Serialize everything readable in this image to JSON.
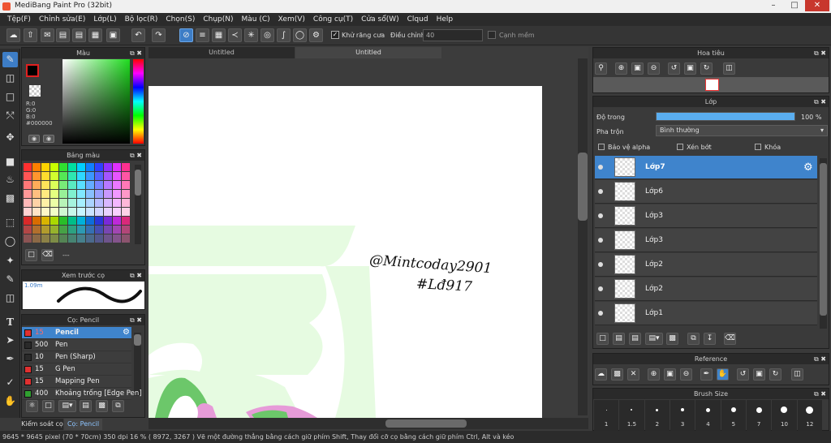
{
  "window": {
    "title": "MediBang Paint Pro (32bit)"
  },
  "menu": [
    "Tệp(F)",
    "Chỉnh sửa(E)",
    "Lớp(L)",
    "Bộ lọc(R)",
    "Chọn(S)",
    "Chụp(N)",
    "Màu (C)",
    "Xem(V)",
    "Công cụ(T)",
    "Cửa sổ(W)",
    "Clqud",
    "Help"
  ],
  "toolbar": {
    "antialias_label": "Khử răng cưa",
    "adjust_label": "Điều chỉnh",
    "adjust_value": "40",
    "edge_label": "Cạnh mềm"
  },
  "color_panel": {
    "title": "Màu",
    "r": "R:0",
    "g": "G:0",
    "b": "B:0",
    "hex": "#000000"
  },
  "palette_panel": {
    "title": "Bảng màu",
    "footer": "---"
  },
  "preview_panel": {
    "title": "Xem trước cọ",
    "size": "1.09m"
  },
  "brush_panel": {
    "title": "Cọ: Pencil",
    "brushes": [
      {
        "size": "15",
        "name": "Pencil",
        "color": "#e03030",
        "selected": true
      },
      {
        "size": "500",
        "name": "Pen",
        "color": "#2a2a2a",
        "selected": false
      },
      {
        "size": "10",
        "name": "Pen (Sharp)",
        "color": "#2a2a2a",
        "selected": false
      },
      {
        "size": "15",
        "name": "G Pen",
        "color": "#e03030",
        "selected": false
      },
      {
        "size": "15",
        "name": "Mapping Pen",
        "color": "#e03030",
        "selected": false
      },
      {
        "size": "400",
        "name": "Khoảng trống [Edge Pen]",
        "color": "#30a030",
        "selected": false
      }
    ]
  },
  "left_tabs": [
    "Kiểm soát cọ",
    "Cọ: Pencil"
  ],
  "doc_tabs": [
    "Untitled",
    "Untitled"
  ],
  "canvas": {
    "handwriting_line1": "@Mintcoday2901",
    "handwriting_line2": "#Lđ917"
  },
  "navigator": {
    "title": "Hoa tiêu"
  },
  "layer_panel": {
    "title": "Lớp",
    "opacity_label": "Độ trong",
    "opacity_value": "100 %",
    "opacity_fraction": 1.0,
    "blend_label": "Pha trộn",
    "blend_value": "Bình thường",
    "protect_alpha": "Bảo vệ alpha",
    "clip": "Xén bớt",
    "lock": "Khóa",
    "layers": [
      {
        "name": "Lớp7",
        "selected": true
      },
      {
        "name": "Lớp6",
        "selected": false
      },
      {
        "name": "Lớp3",
        "selected": false
      },
      {
        "name": "Lớp3",
        "selected": false
      },
      {
        "name": "Lớp2",
        "selected": false
      },
      {
        "name": "Lớp2",
        "selected": false
      },
      {
        "name": "Lớp1",
        "selected": false
      }
    ]
  },
  "reference_panel": {
    "title": "Reference"
  },
  "brush_size_panel": {
    "title": "Brush Size",
    "sizes": [
      "1",
      "1.5",
      "2",
      "3",
      "4",
      "5",
      "7",
      "10",
      "12"
    ]
  },
  "status": {
    "text": "9645 * 9645 pixel  (70 * 70cm)  350 dpi  16 %  ( 8972, 3267 )  Vẽ một đường thẳng bằng cách giữ phím Shift, Thay đổi cỡ cọ bằng cách giữ phím Ctrl, Alt và kéo"
  }
}
